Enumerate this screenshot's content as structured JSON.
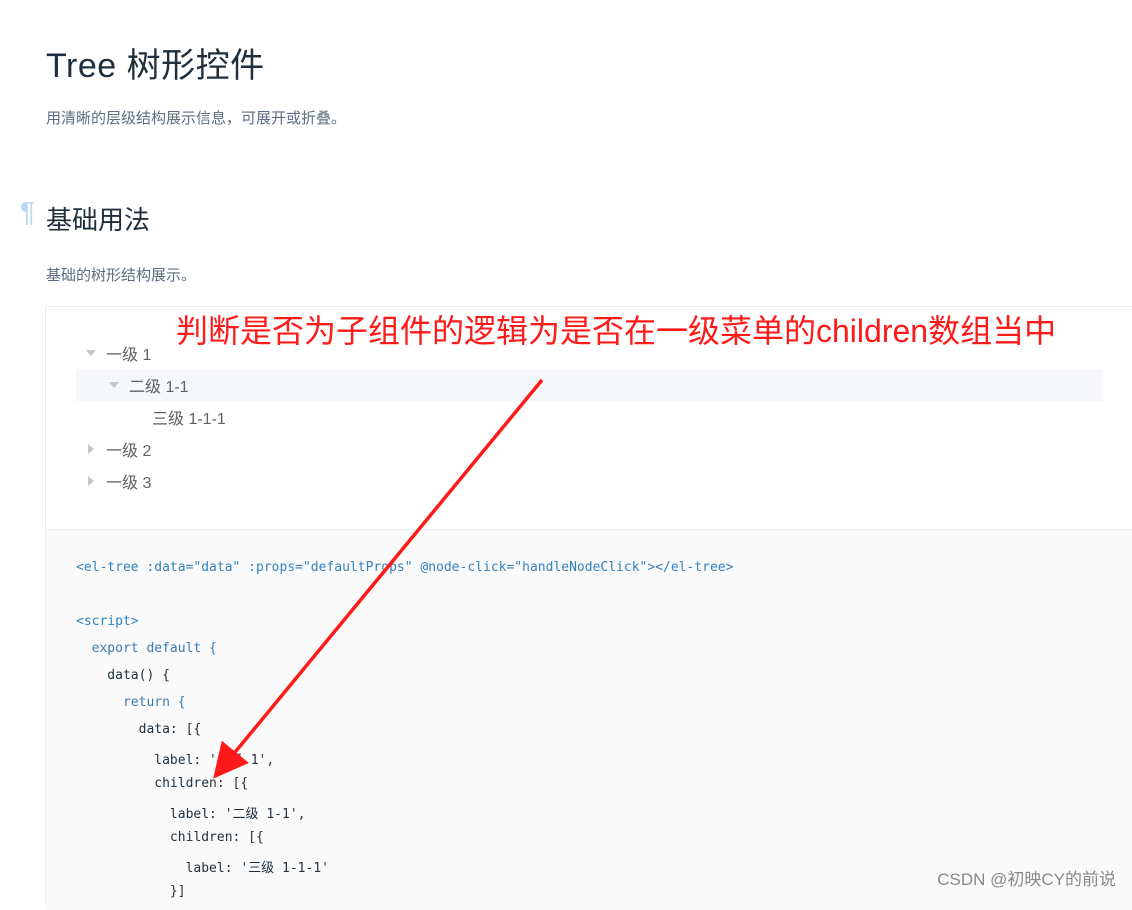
{
  "header": {
    "title": "Tree 树形控件",
    "description": "用清晰的层级结构展示信息，可展开或折叠。"
  },
  "section": {
    "anchor": "¶",
    "title": "基础用法",
    "description": "基础的树形结构展示。"
  },
  "tree": {
    "nodes": [
      {
        "label": "一级 1",
        "level": 1,
        "expanded": true
      },
      {
        "label": "二级 1-1",
        "level": 2,
        "expanded": true,
        "current": true
      },
      {
        "label": "三级 1-1-1",
        "level": 3,
        "leaf": true
      },
      {
        "label": "一级 2",
        "level": 1,
        "expanded": false
      },
      {
        "label": "一级 3",
        "level": 1,
        "expanded": false
      }
    ]
  },
  "code": {
    "lines": [
      "<el-tree :data=\"data\" :props=\"defaultProps\" @node-click=\"handleNodeClick\"></el-tree>",
      "",
      "<script>",
      "  export default {",
      "    data() {",
      "      return {",
      "        data: [{",
      "          label: '一级 1',",
      "          children: [{",
      "            label: '二级 1-1',",
      "            children: [{",
      "              label: '三级 1-1-1'",
      "            }]"
    ]
  },
  "annotation": {
    "text": "判断是否为子组件的逻辑为是否在一级菜单的children数组当中",
    "color": "#ff1a1a"
  },
  "watermark": "CSDN @初映CY的前说"
}
